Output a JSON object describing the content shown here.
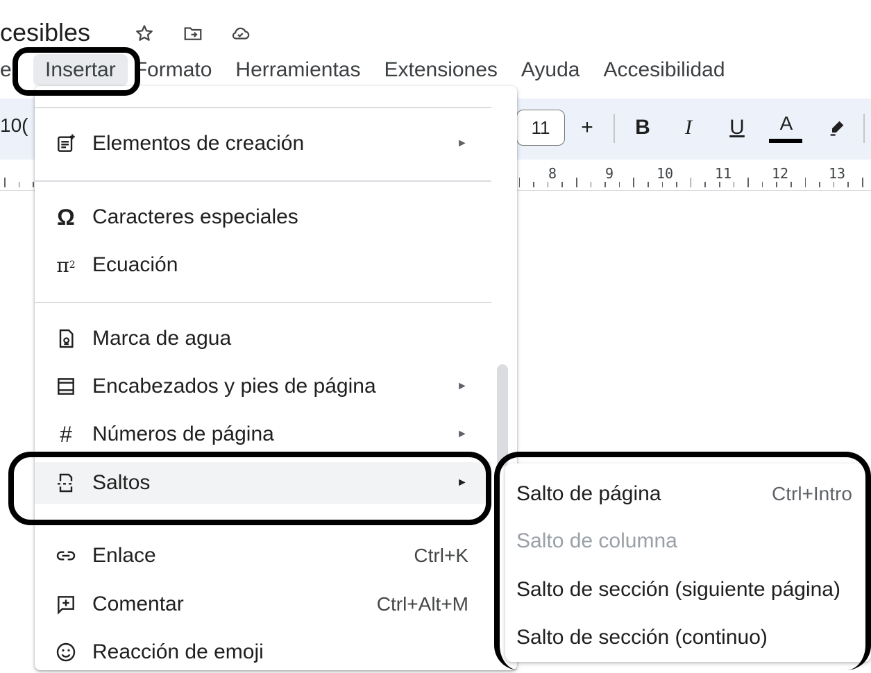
{
  "doc": {
    "title": "cesibles"
  },
  "menubar": {
    "cut_item": "e",
    "items": [
      "Insertar",
      "Formato",
      "Herramientas",
      "Extensiones",
      "Ayuda",
      "Accesibilidad"
    ]
  },
  "toolbar": {
    "zoom_partial": "10(",
    "font_size": "11",
    "plus": "+",
    "bold": "B",
    "italic": "I",
    "underline": "U",
    "text_color": "A",
    "text_color_bar": "#000000"
  },
  "ruler": {
    "numbers": [
      "8",
      "9",
      "10",
      "11",
      "12",
      "13"
    ]
  },
  "insert_menu": {
    "items": [
      {
        "label": "Elementos de creación",
        "icon": "building-blocks-icon",
        "submenu": true
      },
      {
        "label": "Caracteres especiales",
        "icon": "omega-icon",
        "submenu": false
      },
      {
        "label": "Ecuación",
        "icon": "pi-squared-icon",
        "submenu": false
      },
      {
        "label": "Marca de agua",
        "icon": "watermark-icon",
        "submenu": false
      },
      {
        "label": "Encabezados y pies de página",
        "icon": "header-footer-icon",
        "submenu": true
      },
      {
        "label": "Números de página",
        "icon": "hash-icon",
        "submenu": true
      },
      {
        "label": "Saltos",
        "icon": "page-break-icon",
        "submenu": true
      },
      {
        "label": "Enlace",
        "icon": "link-icon",
        "shortcut": "Ctrl+K"
      },
      {
        "label": "Comentar",
        "icon": "add-comment-icon",
        "shortcut": "Ctrl+Alt+M"
      },
      {
        "label": "Reacción de emoji",
        "icon": "emoji-icon"
      }
    ]
  },
  "breaks_submenu": {
    "items": [
      {
        "label": "Salto de página",
        "shortcut": "Ctrl+Intro",
        "disabled": false
      },
      {
        "label": "Salto de columna",
        "disabled": true
      },
      {
        "label": "Salto de sección (siguiente página)",
        "disabled": false
      },
      {
        "label": "Salto de sección (continuo)",
        "disabled": false
      }
    ]
  },
  "colors": {
    "highlight_ring": "#000000",
    "toolbar_bg": "#edf2fa",
    "disabled_text": "#9aa0a6"
  }
}
